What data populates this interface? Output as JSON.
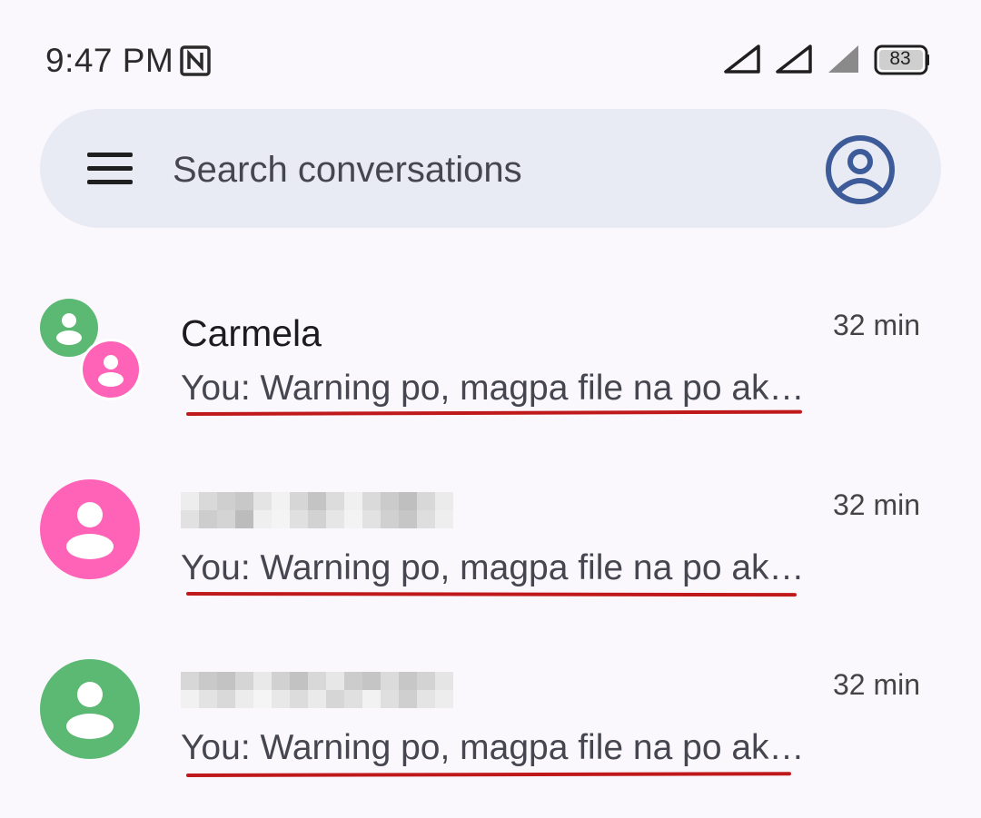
{
  "status_bar": {
    "time": "9:47 PM",
    "battery_level": "83",
    "icons": [
      "nfc-icon",
      "signal-1-icon",
      "signal-2-icon",
      "signal-3-icon",
      "battery-icon"
    ]
  },
  "search": {
    "placeholder": "Search conversations",
    "menu_icon": "hamburger-menu-icon",
    "account_icon": "account-circle-icon"
  },
  "colors": {
    "avatar_green": "#5bb974",
    "avatar_pink": "#ff63b8",
    "underline_red": "#c0191b",
    "searchbar_bg": "#e8eaf4",
    "account_blue": "#3d5a99"
  },
  "conversations": [
    {
      "name": "Carmela",
      "snippet": "You: Warning po, magpa file na po ak…",
      "time": "32 min",
      "avatar": "group-avatar-icon"
    },
    {
      "name": "",
      "snippet": "You: Warning po, magpa file na po ak…",
      "time": "32 min",
      "avatar": "person-avatar-icon",
      "name_redacted": true
    },
    {
      "name": "",
      "snippet": "You: Warning po, magpa file na po ak…",
      "time": "32 min",
      "avatar": "person-avatar-icon",
      "name_redacted": true
    }
  ]
}
